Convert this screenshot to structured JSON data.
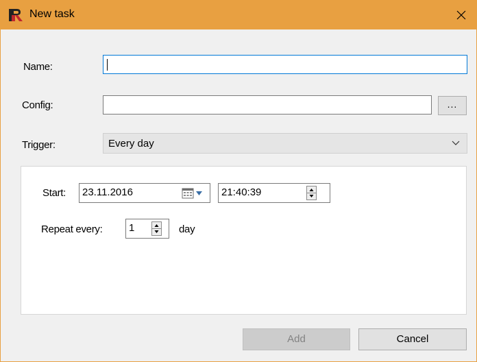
{
  "window": {
    "title": "New task",
    "accent_color": "#e8a041",
    "logo_icon": "app-logo-icon",
    "close_icon": "close-icon"
  },
  "form": {
    "name": {
      "label": "Name:",
      "value": ""
    },
    "config": {
      "label": "Config:",
      "value": "",
      "browse_label": "..."
    },
    "trigger": {
      "label": "Trigger:",
      "value": "Every day"
    }
  },
  "schedule": {
    "start_label": "Start:",
    "start_date": "23.11.2016",
    "start_time": "21:40:39",
    "repeat_label": "Repeat every:",
    "repeat_value": "1",
    "repeat_unit": "day"
  },
  "buttons": {
    "add_label": "Add",
    "add_enabled": false,
    "cancel_label": "Cancel"
  }
}
